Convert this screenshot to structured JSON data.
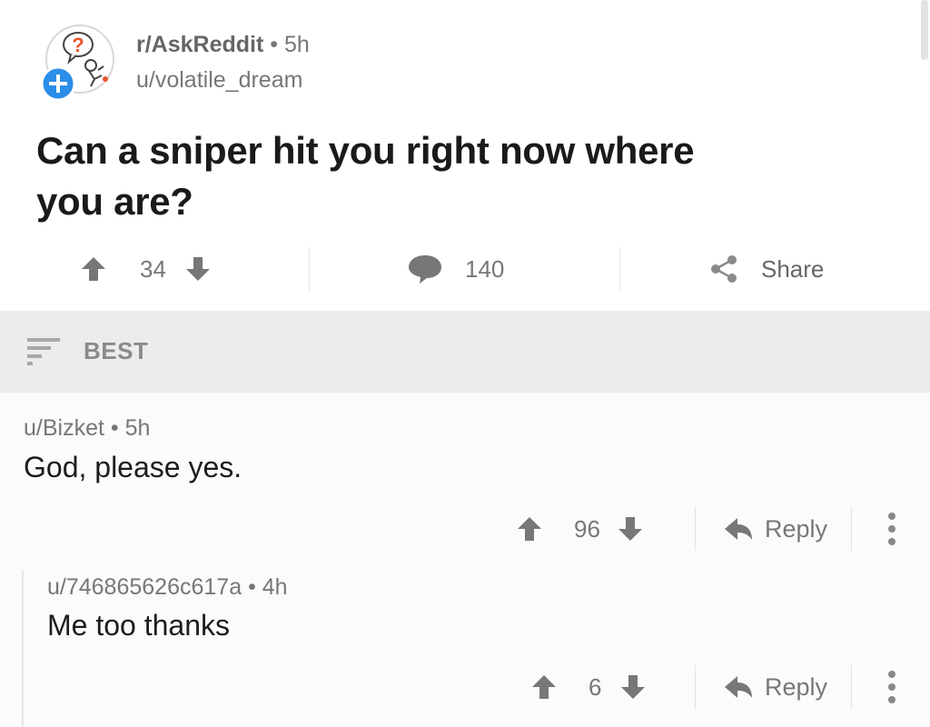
{
  "post": {
    "subreddit": "r/AskReddit",
    "separator": "•",
    "age": "5h",
    "author": "u/volatile_dream",
    "title": "Can a sniper hit you right now where you are?",
    "score": "34",
    "comments": "140",
    "share_label": "Share"
  },
  "sort": {
    "label": "BEST"
  },
  "comments": [
    {
      "author": "u/Bizket",
      "separator": "•",
      "age": "5h",
      "body": "God, please yes.",
      "score": "96",
      "reply_label": "Reply"
    },
    {
      "author": "u/746865626c617a",
      "separator": "•",
      "age": "4h",
      "body": "Me too thanks",
      "score": "6",
      "reply_label": "Reply"
    }
  ],
  "colors": {
    "subreddit_icon_question": "#e8552a",
    "join_button": "#2b8ee8",
    "muted_text": "#777777",
    "sort_bar_bg": "#ececec"
  }
}
